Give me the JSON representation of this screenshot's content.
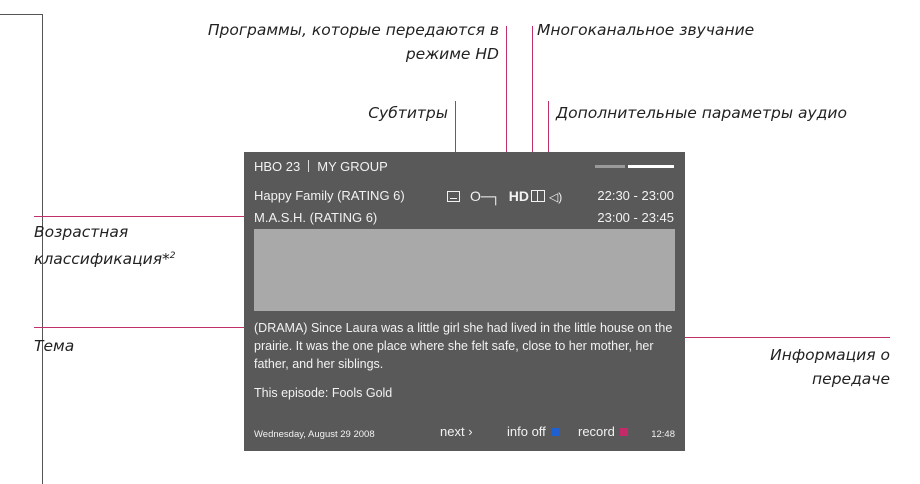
{
  "labels": {
    "hd_programs_line1": "Программы, которые передаются в",
    "hd_programs_line2": "режиме HD",
    "multichannel": "Многоканальное звучание",
    "subtitles": "Субтитры",
    "extra_audio": "Дополнительные параметры аудио",
    "age_rating_line1": "Возрастная",
    "age_rating_line2": "классификация*",
    "age_rating_sup": "2",
    "theme": "Тема",
    "program_info_line1": "Информация о",
    "program_info_line2": "передаче"
  },
  "screen": {
    "channel": "HBO 23",
    "group": "MY GROUP",
    "current_program": "Happy Family (RATING 6)",
    "current_time": "22:30 - 23:00",
    "hd_label": "HD",
    "next_program": "M.A.S.H. (RATING 6)",
    "next_time": "23:00 - 23:45",
    "description": "(DRAMA) Since Laura was a little girl she had lived in the little house on the prairie. It was the one place where she felt safe, close to her mother, her father, and her siblings.",
    "episode": "This episode: Fools Gold",
    "date": "Wednesday, August 29 2008",
    "next_label": "next",
    "info_off_label": "info off",
    "record_label": "record",
    "clock": "12:48"
  },
  "icons": {
    "subtitles": "subtitles-icon",
    "key": "key-icon",
    "dolby": "dolby-icon",
    "audio": "audio-options-icon"
  },
  "colors": {
    "callout_line": "#c0306a",
    "osd_background": "#595959",
    "picture_placeholder": "#a9a9a9",
    "info_off_button": "#1f5fd1",
    "record_button": "#c42a6a"
  }
}
